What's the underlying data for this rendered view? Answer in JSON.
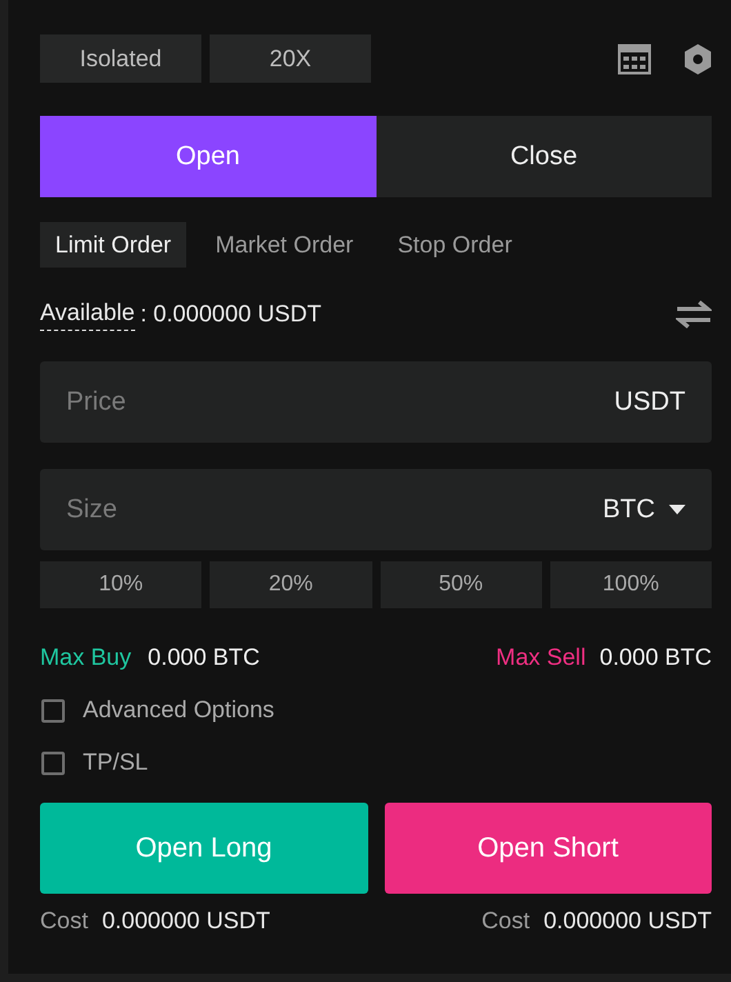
{
  "margin_mode": "Isolated",
  "leverage": "20X",
  "sides": [
    {
      "label": "Open",
      "selected": true
    },
    {
      "label": "Close",
      "selected": false
    }
  ],
  "order_types": [
    {
      "label": "Limit Order",
      "selected": true
    },
    {
      "label": "Market Order",
      "selected": false
    },
    {
      "label": "Stop Order",
      "selected": false
    }
  ],
  "available": {
    "label": "Available",
    "value": ": 0.000000 USDT"
  },
  "price_field": {
    "placeholder": "Price",
    "unit": "USDT"
  },
  "size_field": {
    "placeholder": "Size",
    "unit": "BTC"
  },
  "percentages": [
    "10%",
    "20%",
    "50%",
    "100%"
  ],
  "max_buy": {
    "label": "Max Buy",
    "value": "0.000 BTC"
  },
  "max_sell": {
    "label": "Max Sell",
    "value": "0.000 BTC"
  },
  "options": [
    {
      "label": "Advanced Options",
      "checked": false
    },
    {
      "label": "TP/SL",
      "checked": false
    }
  ],
  "actions": [
    {
      "label": "Open Long",
      "kind": "long"
    },
    {
      "label": "Open Short",
      "kind": "short"
    }
  ],
  "costs": [
    {
      "label": "Cost",
      "value": "0.000000 USDT"
    },
    {
      "label": "Cost",
      "value": "0.000000 USDT"
    }
  ]
}
